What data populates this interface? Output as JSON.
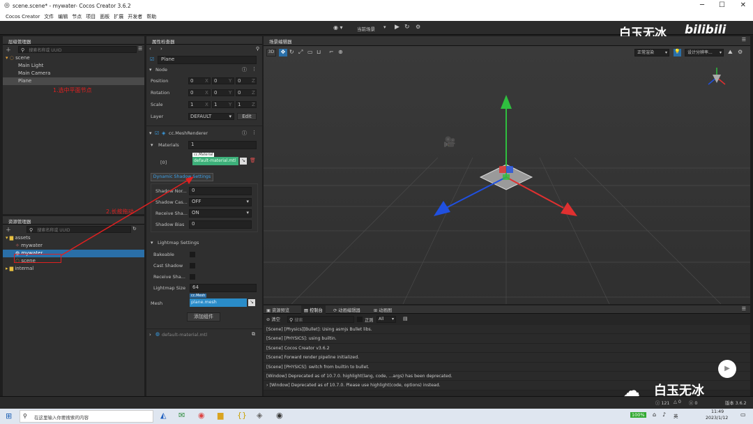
{
  "title": "scene.scene* - mywater- Cocos Creator 3.6.2",
  "menus": [
    "Cocos Creator",
    "文件",
    "编辑",
    "节点",
    "项目",
    "面板",
    "扩展",
    "开发者",
    "帮助"
  ],
  "toolbar": {
    "scene_select": "当前场景"
  },
  "watermark": {
    "channel": "白玉无冰",
    "logo": "bilibili",
    "bottom": "白玉无冰"
  },
  "hierarchy": {
    "title": "层级管理器",
    "search": "搜索名称或 UUID",
    "nodes": [
      "scene",
      "Main Light",
      "Main Camera",
      "Plane"
    ]
  },
  "assets": {
    "title": "资源管理器",
    "search": "搜索名称或 UUID",
    "items": [
      "assets",
      "mywater",
      "mywater",
      "scene",
      "internal"
    ]
  },
  "annotations": {
    "step1": "1.选中平面节点",
    "step2": "2.长按拖动"
  },
  "inspector": {
    "title": "属性检查器",
    "node_name": "Plane",
    "section_node": "Node",
    "position_label": "Position",
    "rotation_label": "Rotation",
    "scale_label": "Scale",
    "layer_label": "Layer",
    "position": [
      "0",
      "0",
      "0"
    ],
    "rotation": [
      "0",
      "0",
      "0"
    ],
    "scale": [
      "1",
      "1",
      "1"
    ],
    "axes": [
      "X",
      "Y",
      "Z"
    ],
    "layer": "DEFAULT",
    "edit": "Edit",
    "mesh_renderer": "cc.MeshRenderer",
    "materials_label": "Materials",
    "materials_count": "1",
    "mat_index": "[0]",
    "mat_type": "cc.Material",
    "mat_value": "default-material.mtl",
    "dyn_shadow": "Dynamic Shadow Settings",
    "shadow_normal_label": "Shadow Nor...",
    "shadow_normal": "0",
    "shadow_cast_label": "Shadow Cas...",
    "shadow_cast": "OFF",
    "receive_shadow_label": "Receive Sha...",
    "receive_shadow": "ON",
    "shadow_bias_label": "Shadow Bias",
    "shadow_bias": "0",
    "lightmap": "Lightmap Settings",
    "bakeable": "Bakeable",
    "cast_shadow": "Cast Shadow",
    "receive_sha": "Receive Sha...",
    "lightmap_size_label": "Lightmap Size",
    "lightmap_size": "64",
    "mesh_label": "Mesh",
    "mesh_type": "cc.Mesh",
    "mesh_value": "plane.mesh",
    "add_component": "添加组件",
    "footer": "default-material.mtl"
  },
  "scene_editor": {
    "title": "场景编辑器",
    "btn3d": "3D",
    "view_mode": "正常渲染",
    "resolution": "设计分辨率..."
  },
  "console": {
    "tabs": [
      "资源预览",
      "控制台",
      "动画编辑器",
      "动画图"
    ],
    "clear": "清空",
    "search": "搜索",
    "regex": "正则",
    "level": "All",
    "logs": [
      "[Scene] [Physics][Bullet]: Using asmjs Bullet libs.",
      "[Scene] [PHYSICS]: using builtin.",
      "[Scene] Cocos Creator v3.6.2",
      "[Scene] Forward render pipeline initialized.",
      "[Scene] [PHYSICS]: switch from builtin to bullet.",
      "[Window] Deprecated as of 10.7.0. highlight(lang, code, ...args) has been deprecated.",
      "[Window] Deprecated as of 10.7.0. Please use highlight(code, options) instead."
    ]
  },
  "statusbar": {
    "c1": "121",
    "c2": "0",
    "c3": "0",
    "version": "版本 3.6.2"
  },
  "taskbar": {
    "search": "在这里输入你要搜索的内容",
    "battery": "100%",
    "ime": "英",
    "time": "11:49",
    "date": "2023/1/12"
  }
}
